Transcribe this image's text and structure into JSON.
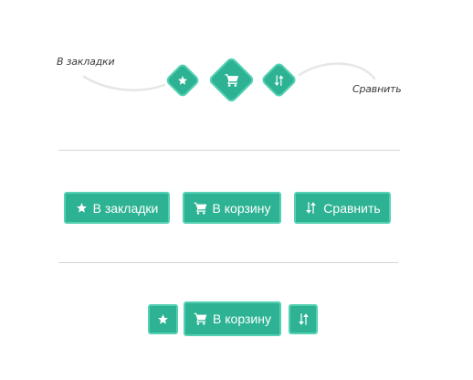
{
  "variant_diamonds": {
    "bookmark_hint": "В закладки",
    "compare_hint": "Сравнить",
    "icons": [
      "star-icon",
      "cart-icon",
      "compare-arrows-icon"
    ]
  },
  "variant_labeled": {
    "bookmark_label": "В закладки",
    "cart_label": "В корзину",
    "compare_label": "Сравнить"
  },
  "variant_compact": {
    "cart_label": "В корзину"
  },
  "colors": {
    "accent": "#2db394",
    "accent_border": "#55d1b2",
    "divider": "#d6d6d6",
    "text": "#3a3a3a"
  }
}
